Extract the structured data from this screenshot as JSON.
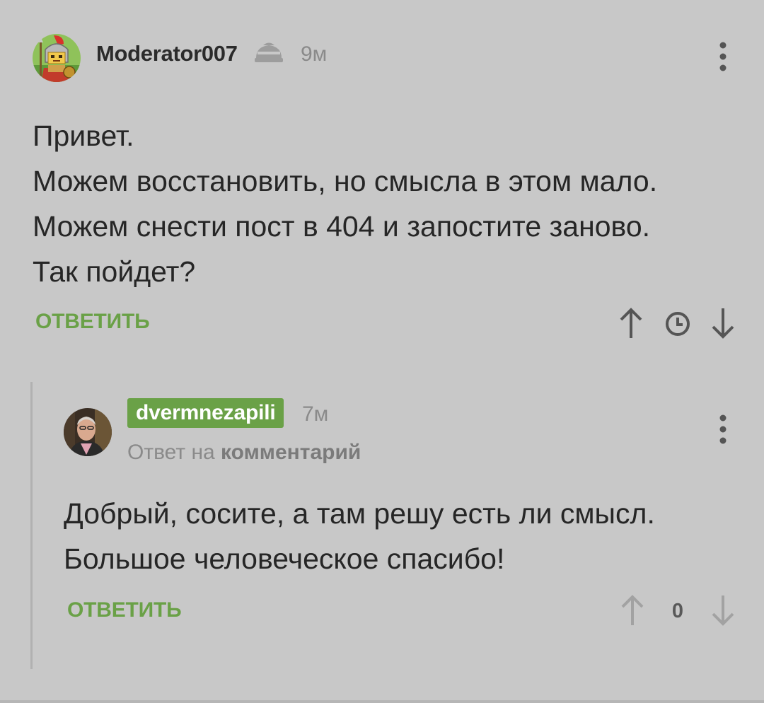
{
  "comments": [
    {
      "author": "Moderator007",
      "time": "9м",
      "text_lines": [
        "Привет.",
        "Можем восстановить, но смысла в этом мало.",
        "Можем снести пост в 404 и запостите заново.",
        "Так пойдет?"
      ],
      "reply_label": "ОТВЕТИТЬ",
      "icons": [
        "avatar-knight",
        "moderator-helmet-icon",
        "more-vertical-icon",
        "arrow-up-icon",
        "clock-icon",
        "arrow-down-icon"
      ]
    },
    {
      "author": "dvermnezapili",
      "time": "7м",
      "reply_to_prefix": "Ответ на",
      "reply_to_target": "комментарий",
      "text_lines": [
        "Добрый, сосите, а там решу есть ли смысл.",
        "Большое человеческое спасибо!"
      ],
      "reply_label": "ОТВЕТИТЬ",
      "score": "0",
      "icons": [
        "avatar-photo",
        "more-vertical-icon",
        "arrow-up-icon",
        "arrow-down-icon"
      ]
    }
  ],
  "colors": {
    "background": "#c8c8c8",
    "accent_green": "#6aa147",
    "text": "#262626",
    "muted": "#8a8a8a",
    "icon_dark": "#555555",
    "icon_light": "#9d9d9d"
  }
}
